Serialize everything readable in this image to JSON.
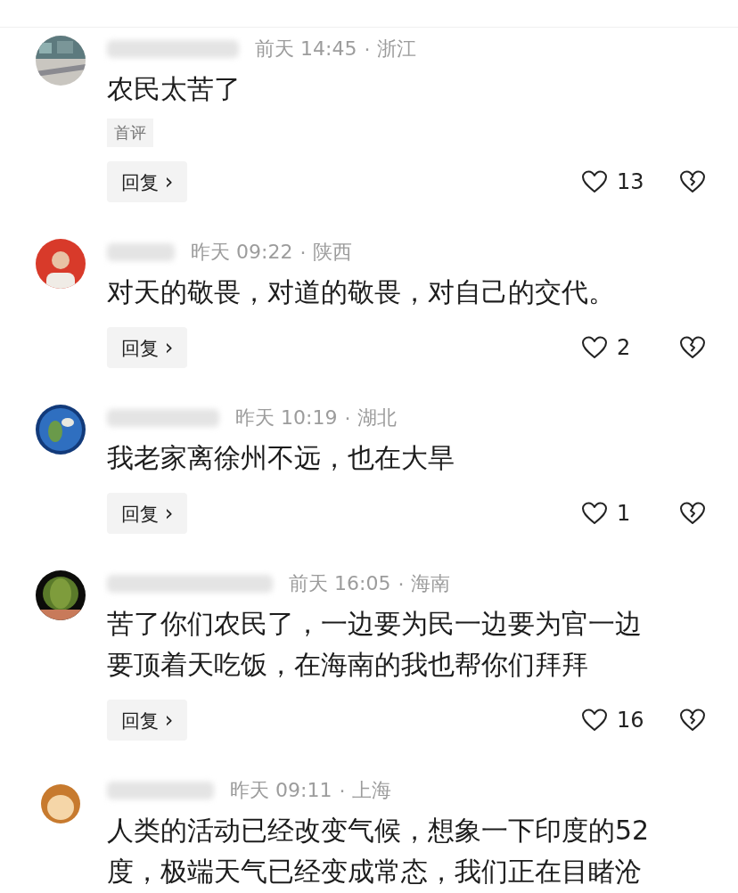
{
  "comments": [
    {
      "time": "前天 14:45",
      "separator": "·",
      "location": "浙江",
      "content": "农民太苦了",
      "tag": "首评",
      "reply": "回复",
      "chevron": "›",
      "likes": "13"
    },
    {
      "time": "昨天 09:22",
      "separator": "·",
      "location": "陕西",
      "content": "对天的敬畏，对道的敬畏，对自己的交代。",
      "reply": "回复",
      "chevron": "›",
      "likes": "2"
    },
    {
      "time": "昨天 10:19",
      "separator": "·",
      "location": "湖北",
      "content": "我老家离徐州不远，也在大旱",
      "reply": "回复",
      "chevron": "›",
      "likes": "1"
    },
    {
      "time": "前天 16:05",
      "separator": "·",
      "location": "海南",
      "content": "苦了你们农民了，一边要为民一边要为官一边要顶着天吃饭，在海南的我也帮你们拜拜",
      "reply": "回复",
      "chevron": "›",
      "likes": "16"
    },
    {
      "time": "昨天 09:11",
      "separator": "·",
      "location": "上海",
      "content": "人类的活动已经改变气候，想象一下印度的52度，极端天气已经变成常态，我们正在目睹沧"
    }
  ]
}
